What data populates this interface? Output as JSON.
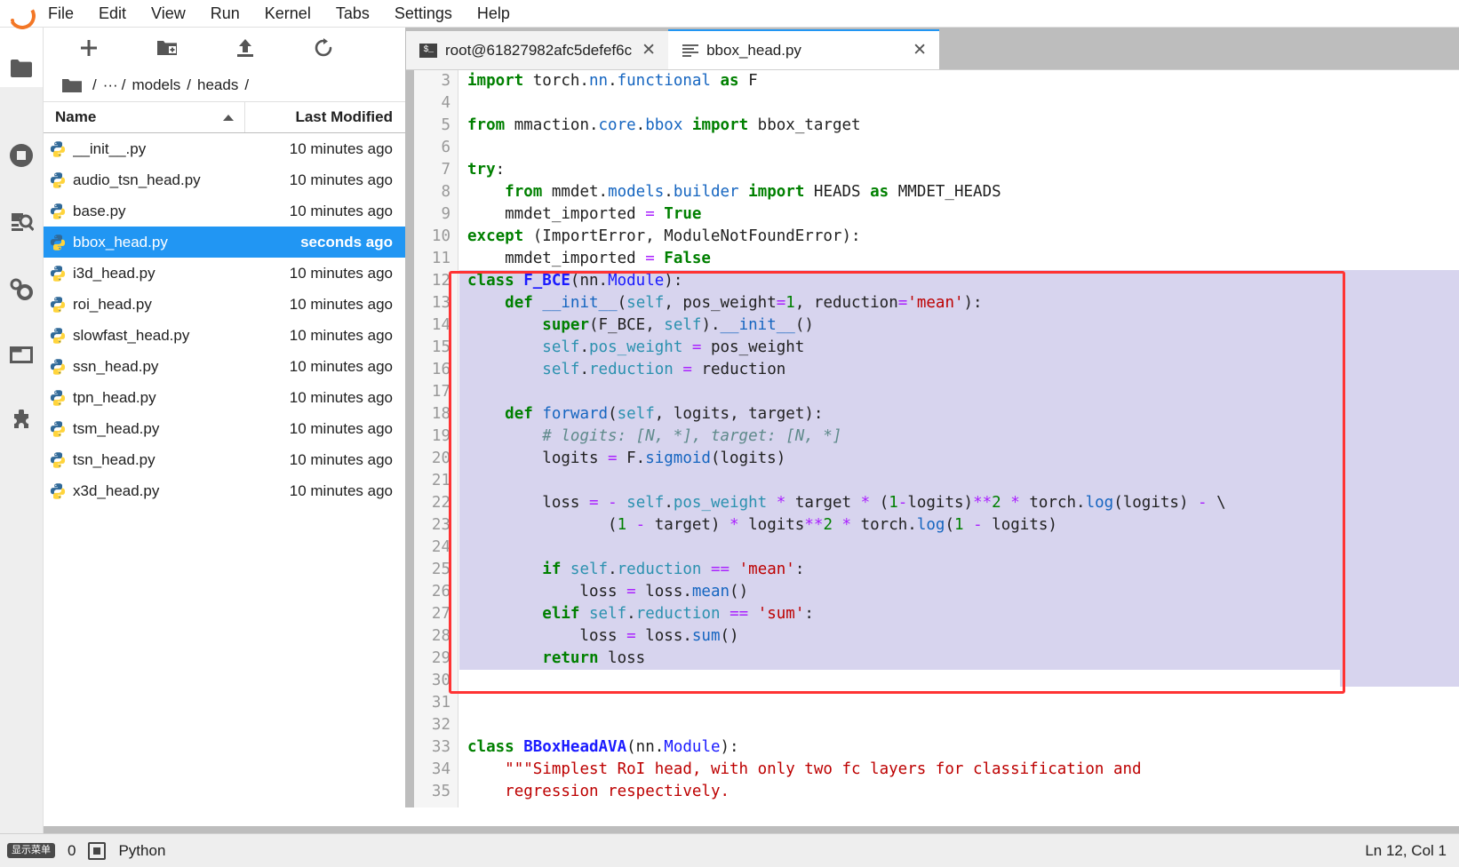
{
  "menubar": {
    "logo": "jupyter-logo",
    "items": [
      "File",
      "Edit",
      "View",
      "Run",
      "Kernel",
      "Tabs",
      "Settings",
      "Help"
    ]
  },
  "activitybar": {
    "items": [
      {
        "name": "file-browser-icon",
        "label": "File Browser",
        "selected": true
      },
      {
        "name": "running-terminals-icon",
        "label": "Running Terminals and Kernels",
        "selected": false
      },
      {
        "name": "document-search-icon",
        "label": "Search",
        "selected": false
      },
      {
        "name": "settings-gears-icon",
        "label": "Property Inspector",
        "selected": false
      },
      {
        "name": "open-tabs-icon",
        "label": "Open Tabs",
        "selected": false
      },
      {
        "name": "extension-manager-icon",
        "label": "Extension Manager",
        "selected": false
      }
    ]
  },
  "filebrowser": {
    "toolbar": [
      {
        "name": "new-launcher-button",
        "glyph": "+"
      },
      {
        "name": "new-folder-button",
        "glyph": "folder-plus"
      },
      {
        "name": "upload-button",
        "glyph": "upload-arrow"
      },
      {
        "name": "refresh-button",
        "glyph": "refresh"
      }
    ],
    "breadcrumb": {
      "home_icon": "folder-icon",
      "parts": [
        "/",
        "···",
        "/",
        "models",
        "/",
        "heads",
        "/"
      ]
    },
    "columns": {
      "name": "Name",
      "modified": "Last Modified"
    },
    "sort": "ascending",
    "selected_color": "#2196f3",
    "files": [
      {
        "name": "__init__.py",
        "modified": "10 minutes ago",
        "selected": false
      },
      {
        "name": "audio_tsn_head.py",
        "modified": "10 minutes ago",
        "selected": false
      },
      {
        "name": "base.py",
        "modified": "10 minutes ago",
        "selected": false
      },
      {
        "name": "bbox_head.py",
        "modified": "seconds ago",
        "selected": true
      },
      {
        "name": "i3d_head.py",
        "modified": "10 minutes ago",
        "selected": false
      },
      {
        "name": "roi_head.py",
        "modified": "10 minutes ago",
        "selected": false
      },
      {
        "name": "slowfast_head.py",
        "modified": "10 minutes ago",
        "selected": false
      },
      {
        "name": "ssn_head.py",
        "modified": "10 minutes ago",
        "selected": false
      },
      {
        "name": "tpn_head.py",
        "modified": "10 minutes ago",
        "selected": false
      },
      {
        "name": "tsm_head.py",
        "modified": "10 minutes ago",
        "selected": false
      },
      {
        "name": "tsn_head.py",
        "modified": "10 minutes ago",
        "selected": false
      },
      {
        "name": "x3d_head.py",
        "modified": "10 minutes ago",
        "selected": false
      }
    ]
  },
  "tabs": [
    {
      "label": "root@61827982afc5defef6c",
      "icon": "terminal-icon",
      "active": false,
      "closable": true
    },
    {
      "label": "bbox_head.py",
      "icon": "text-file-icon",
      "active": true,
      "closable": true
    }
  ],
  "editor": {
    "first_line_number": 3,
    "highlight_color": "#d7d4ee",
    "annotation_color": "#ff3333",
    "lines": [
      {
        "n": 3,
        "hl": false,
        "tokens": [
          [
            "kw",
            "import"
          ],
          [
            "pln",
            " torch."
          ],
          [
            "bi",
            "nn"
          ],
          [
            "pln",
            "."
          ],
          [
            "bi",
            "functional"
          ],
          [
            "pln",
            " "
          ],
          [
            "kw",
            "as"
          ],
          [
            "pln",
            " F"
          ]
        ]
      },
      {
        "n": 4,
        "hl": false,
        "tokens": [
          [
            "pln",
            ""
          ]
        ]
      },
      {
        "n": 5,
        "hl": false,
        "tokens": [
          [
            "kw",
            "from"
          ],
          [
            "pln",
            " mmaction."
          ],
          [
            "bi",
            "core"
          ],
          [
            "pln",
            "."
          ],
          [
            "bi",
            "bbox"
          ],
          [
            "pln",
            " "
          ],
          [
            "kw",
            "import"
          ],
          [
            "pln",
            " bbox_target"
          ]
        ]
      },
      {
        "n": 6,
        "hl": false,
        "tokens": [
          [
            "pln",
            ""
          ]
        ]
      },
      {
        "n": 7,
        "hl": false,
        "tokens": [
          [
            "kw",
            "try"
          ],
          [
            "pln",
            ":"
          ]
        ]
      },
      {
        "n": 8,
        "hl": false,
        "tokens": [
          [
            "pln",
            "    "
          ],
          [
            "kw",
            "from"
          ],
          [
            "pln",
            " mmdet."
          ],
          [
            "bi",
            "models"
          ],
          [
            "pln",
            "."
          ],
          [
            "bi",
            "builder"
          ],
          [
            "pln",
            " "
          ],
          [
            "kw",
            "import"
          ],
          [
            "pln",
            " HEADS "
          ],
          [
            "kw",
            "as"
          ],
          [
            "pln",
            " MMDET_HEADS"
          ]
        ]
      },
      {
        "n": 9,
        "hl": false,
        "tokens": [
          [
            "pln",
            "    mmdet_imported "
          ],
          [
            "op",
            "="
          ],
          [
            "pln",
            " "
          ],
          [
            "kw",
            "True"
          ]
        ]
      },
      {
        "n": 10,
        "hl": false,
        "tokens": [
          [
            "kw",
            "except"
          ],
          [
            "pln",
            " (ImportError, ModuleNotFoundError):"
          ]
        ]
      },
      {
        "n": 11,
        "hl": false,
        "tokens": [
          [
            "pln",
            "    mmdet_imported "
          ],
          [
            "op",
            "="
          ],
          [
            "pln",
            " "
          ],
          [
            "kw",
            "False"
          ]
        ]
      },
      {
        "n": 12,
        "hl": true,
        "tokens": [
          [
            "kw",
            "class"
          ],
          [
            "pln",
            " "
          ],
          [
            "cls",
            "F_BCE"
          ],
          [
            "pln",
            "(nn."
          ],
          [
            "clsname",
            "Module"
          ],
          [
            "pln",
            "):"
          ]
        ]
      },
      {
        "n": 13,
        "hl": true,
        "tokens": [
          [
            "pln",
            "    "
          ],
          [
            "kw",
            "def"
          ],
          [
            "pln",
            " "
          ],
          [
            "bi",
            "__init__"
          ],
          [
            "pln",
            "("
          ],
          [
            "self",
            "self"
          ],
          [
            "pln",
            ", pos_weight"
          ],
          [
            "op",
            "="
          ],
          [
            "num",
            "1"
          ],
          [
            "pln",
            ", reduction"
          ],
          [
            "op",
            "="
          ],
          [
            "str",
            "'mean'"
          ],
          [
            "pln",
            "):"
          ]
        ]
      },
      {
        "n": 14,
        "hl": true,
        "tokens": [
          [
            "pln",
            "        "
          ],
          [
            "kw",
            "super"
          ],
          [
            "pln",
            "(F_BCE, "
          ],
          [
            "self",
            "self"
          ],
          [
            "pln",
            ")."
          ],
          [
            "bi",
            "__init__"
          ],
          [
            "pln",
            "()"
          ]
        ]
      },
      {
        "n": 15,
        "hl": true,
        "tokens": [
          [
            "pln",
            "        "
          ],
          [
            "self",
            "self"
          ],
          [
            "pln",
            "."
          ],
          [
            "attr",
            "pos_weight"
          ],
          [
            "pln",
            " "
          ],
          [
            "op",
            "="
          ],
          [
            "pln",
            " pos_weight"
          ]
        ]
      },
      {
        "n": 16,
        "hl": true,
        "tokens": [
          [
            "pln",
            "        "
          ],
          [
            "self",
            "self"
          ],
          [
            "pln",
            "."
          ],
          [
            "attr",
            "reduction"
          ],
          [
            "pln",
            " "
          ],
          [
            "op",
            "="
          ],
          [
            "pln",
            " reduction"
          ]
        ]
      },
      {
        "n": 17,
        "hl": true,
        "tokens": [
          [
            "pln",
            ""
          ]
        ]
      },
      {
        "n": 18,
        "hl": true,
        "tokens": [
          [
            "pln",
            "    "
          ],
          [
            "kw",
            "def"
          ],
          [
            "pln",
            " "
          ],
          [
            "bi",
            "forward"
          ],
          [
            "pln",
            "("
          ],
          [
            "self",
            "self"
          ],
          [
            "pln",
            ", logits, target):"
          ]
        ]
      },
      {
        "n": 19,
        "hl": true,
        "tokens": [
          [
            "pln",
            "        "
          ],
          [
            "cmt",
            "# logits: [N, *], target: [N, *]"
          ]
        ]
      },
      {
        "n": 20,
        "hl": true,
        "tokens": [
          [
            "pln",
            "        logits "
          ],
          [
            "op",
            "="
          ],
          [
            "pln",
            " F."
          ],
          [
            "bi",
            "sigmoid"
          ],
          [
            "pln",
            "(logits)"
          ]
        ]
      },
      {
        "n": 21,
        "hl": true,
        "tokens": [
          [
            "pln",
            ""
          ]
        ]
      },
      {
        "n": 22,
        "hl": true,
        "tokens": [
          [
            "pln",
            "        loss "
          ],
          [
            "op",
            "="
          ],
          [
            "pln",
            " "
          ],
          [
            "op",
            "-"
          ],
          [
            "pln",
            " "
          ],
          [
            "self",
            "self"
          ],
          [
            "pln",
            "."
          ],
          [
            "attr",
            "pos_weight"
          ],
          [
            "pln",
            " "
          ],
          [
            "op",
            "*"
          ],
          [
            "pln",
            " target "
          ],
          [
            "op",
            "*"
          ],
          [
            "pln",
            " ("
          ],
          [
            "num",
            "1"
          ],
          [
            "op",
            "-"
          ],
          [
            "pln",
            "logits)"
          ],
          [
            "op",
            "**"
          ],
          [
            "num",
            "2"
          ],
          [
            "pln",
            " "
          ],
          [
            "op",
            "*"
          ],
          [
            "pln",
            " torch."
          ],
          [
            "bi",
            "log"
          ],
          [
            "pln",
            "(logits) "
          ],
          [
            "op",
            "-"
          ],
          [
            "pln",
            " \\"
          ]
        ]
      },
      {
        "n": 23,
        "hl": true,
        "tokens": [
          [
            "pln",
            "               ("
          ],
          [
            "num",
            "1"
          ],
          [
            "pln",
            " "
          ],
          [
            "op",
            "-"
          ],
          [
            "pln",
            " target) "
          ],
          [
            "op",
            "*"
          ],
          [
            "pln",
            " logits"
          ],
          [
            "op",
            "**"
          ],
          [
            "num",
            "2"
          ],
          [
            "pln",
            " "
          ],
          [
            "op",
            "*"
          ],
          [
            "pln",
            " torch."
          ],
          [
            "bi",
            "log"
          ],
          [
            "pln",
            "("
          ],
          [
            "num",
            "1"
          ],
          [
            "pln",
            " "
          ],
          [
            "op",
            "-"
          ],
          [
            "pln",
            " logits)"
          ]
        ]
      },
      {
        "n": 24,
        "hl": true,
        "tokens": [
          [
            "pln",
            ""
          ]
        ]
      },
      {
        "n": 25,
        "hl": true,
        "tokens": [
          [
            "pln",
            "        "
          ],
          [
            "kw",
            "if"
          ],
          [
            "pln",
            " "
          ],
          [
            "self",
            "self"
          ],
          [
            "pln",
            "."
          ],
          [
            "attr",
            "reduction"
          ],
          [
            "pln",
            " "
          ],
          [
            "op",
            "=="
          ],
          [
            "pln",
            " "
          ],
          [
            "str",
            "'mean'"
          ],
          [
            "pln",
            ":"
          ]
        ]
      },
      {
        "n": 26,
        "hl": true,
        "tokens": [
          [
            "pln",
            "            loss "
          ],
          [
            "op",
            "="
          ],
          [
            "pln",
            " loss."
          ],
          [
            "bi",
            "mean"
          ],
          [
            "pln",
            "()"
          ]
        ]
      },
      {
        "n": 27,
        "hl": true,
        "tokens": [
          [
            "pln",
            "        "
          ],
          [
            "kw",
            "elif"
          ],
          [
            "pln",
            " "
          ],
          [
            "self",
            "self"
          ],
          [
            "pln",
            "."
          ],
          [
            "attr",
            "reduction"
          ],
          [
            "pln",
            " "
          ],
          [
            "op",
            "=="
          ],
          [
            "pln",
            " "
          ],
          [
            "str",
            "'sum'"
          ],
          [
            "pln",
            ":"
          ]
        ]
      },
      {
        "n": 28,
        "hl": true,
        "tokens": [
          [
            "pln",
            "            loss "
          ],
          [
            "op",
            "="
          ],
          [
            "pln",
            " loss."
          ],
          [
            "bi",
            "sum"
          ],
          [
            "pln",
            "()"
          ]
        ]
      },
      {
        "n": 29,
        "hl": true,
        "tokens": [
          [
            "pln",
            "        "
          ],
          [
            "kw",
            "return"
          ],
          [
            "pln",
            " loss"
          ]
        ]
      },
      {
        "n": 30,
        "hl": false,
        "tokens": [
          [
            "pln",
            ""
          ]
        ]
      },
      {
        "n": 31,
        "hl": false,
        "tokens": [
          [
            "pln",
            ""
          ]
        ]
      },
      {
        "n": 32,
        "hl": false,
        "tokens": [
          [
            "pln",
            ""
          ]
        ]
      },
      {
        "n": 33,
        "hl": false,
        "tokens": [
          [
            "kw",
            "class"
          ],
          [
            "pln",
            " "
          ],
          [
            "cls",
            "BBoxHeadAVA"
          ],
          [
            "pln",
            "(nn."
          ],
          [
            "clsname",
            "Module"
          ],
          [
            "pln",
            "):"
          ]
        ]
      },
      {
        "n": 34,
        "hl": false,
        "tokens": [
          [
            "pln",
            "    "
          ],
          [
            "doc",
            "\"\"\"Simplest RoI head, with only two fc layers for classification and"
          ]
        ]
      },
      {
        "n": 35,
        "hl": false,
        "tokens": [
          [
            "pln",
            "    "
          ],
          [
            "doc",
            "regression respectively."
          ]
        ]
      }
    ]
  },
  "statusbar": {
    "ime_badge": "显示菜单",
    "terminal_count": "0",
    "kernel_icon": "kernel-chip-icon",
    "kernel_name": "Python",
    "cursor_position": "Ln 12, Col 1"
  }
}
